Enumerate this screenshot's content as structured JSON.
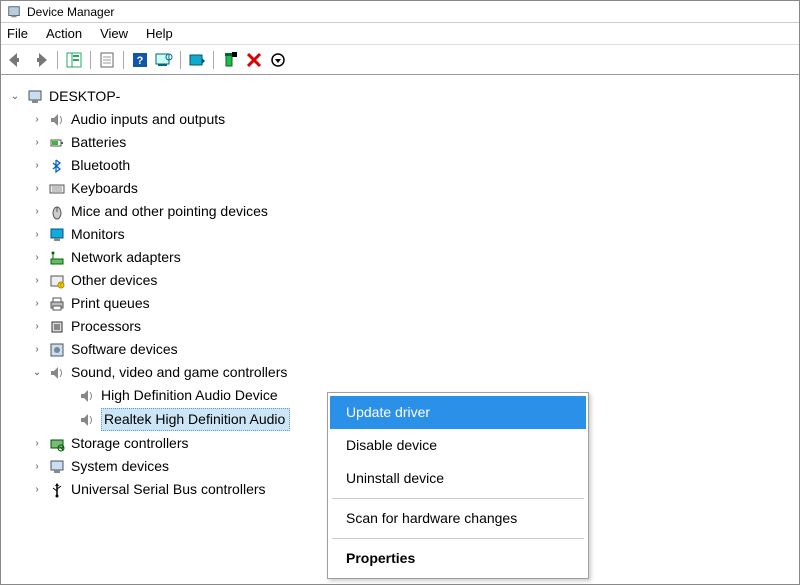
{
  "window": {
    "title": "Device Manager"
  },
  "menu": {
    "items": [
      "File",
      "Action",
      "View",
      "Help"
    ]
  },
  "toolbar": {
    "icons": [
      "back-icon",
      "forward-icon",
      "show-hide-tree-icon",
      "properties-page-icon",
      "help-icon",
      "scan-hardware-icon",
      "update-driver-tb-icon",
      "uninstall-tb-icon",
      "disable-tb-icon",
      "arrow-circle-icon"
    ]
  },
  "tree": {
    "root": {
      "label": "DESKTOP-",
      "icon": "computer-icon",
      "expanded": true
    },
    "categories": [
      {
        "label": "Audio inputs and outputs",
        "icon": "speaker-icon",
        "expanded": false
      },
      {
        "label": "Batteries",
        "icon": "battery-icon",
        "expanded": false
      },
      {
        "label": "Bluetooth",
        "icon": "bluetooth-icon",
        "expanded": false
      },
      {
        "label": "Keyboards",
        "icon": "keyboard-icon",
        "expanded": false
      },
      {
        "label": "Mice and other pointing devices",
        "icon": "mouse-icon",
        "expanded": false
      },
      {
        "label": "Monitors",
        "icon": "monitor-icon",
        "expanded": false
      },
      {
        "label": "Network adapters",
        "icon": "network-icon",
        "expanded": false
      },
      {
        "label": "Other devices",
        "icon": "other-icon",
        "expanded": false
      },
      {
        "label": "Print queues",
        "icon": "printer-icon",
        "expanded": false
      },
      {
        "label": "Processors",
        "icon": "cpu-icon",
        "expanded": false
      },
      {
        "label": "Software devices",
        "icon": "software-icon",
        "expanded": false
      },
      {
        "label": "Sound, video and game controllers",
        "icon": "speaker-icon",
        "expanded": true,
        "children": [
          {
            "label": "High Definition Audio Device",
            "icon": "speaker-icon",
            "selected": false
          },
          {
            "label": "Realtek High Definition Audio",
            "icon": "speaker-icon",
            "selected": true
          }
        ]
      },
      {
        "label": "Storage controllers",
        "icon": "storage-icon",
        "expanded": false
      },
      {
        "label": "System devices",
        "icon": "system-icon",
        "expanded": false
      },
      {
        "label": "Universal Serial Bus controllers",
        "icon": "usb-icon",
        "expanded": false
      }
    ]
  },
  "context_menu": {
    "items": [
      {
        "label": "Update driver",
        "highlight": true
      },
      {
        "label": "Disable device",
        "highlight": false
      },
      {
        "label": "Uninstall device",
        "highlight": false
      },
      {
        "separator": true
      },
      {
        "label": "Scan for hardware changes",
        "highlight": false
      },
      {
        "separator": true
      },
      {
        "label": "Properties",
        "highlight": false,
        "bold": true
      }
    ]
  }
}
